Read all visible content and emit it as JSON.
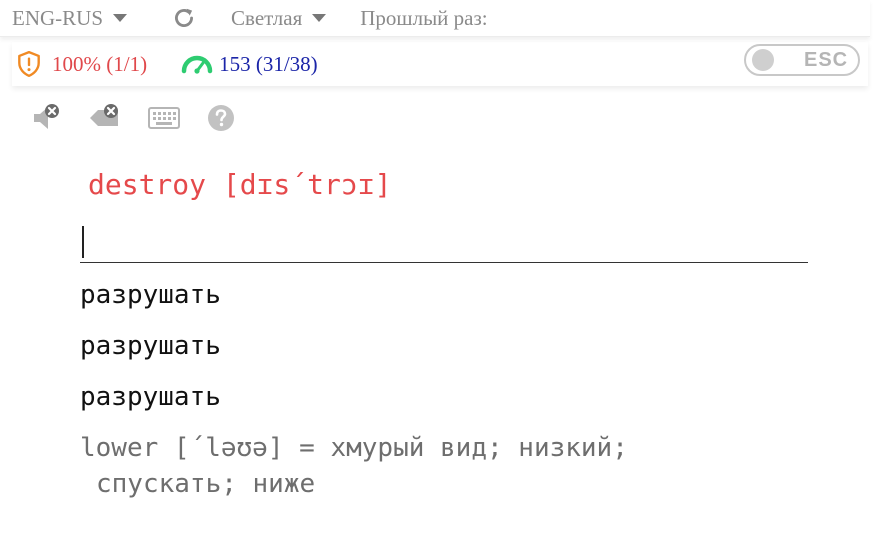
{
  "topbar": {
    "direction_label": "ENG-RUS",
    "theme_label": "Светлая",
    "last_time_label": "Прошлый раз:"
  },
  "stats": {
    "accuracy_text": "100% (1/1)",
    "speed_text": "153 (31/38)"
  },
  "esc_toggle": {
    "label": "ESC"
  },
  "toolbar": {
    "icons": [
      "mute-icon",
      "clear-icon",
      "keyboard-icon",
      "help-icon"
    ]
  },
  "card": {
    "word": "destroy [dɪs´trɔɪ]",
    "answer_value": "",
    "options": [
      "разрушать",
      "разрушать",
      "разрушать"
    ],
    "hint_line1": "lower [´ləʊə] = хмурый вид; низкий;",
    "hint_line2": "спускать; ниже"
  },
  "colors": {
    "word": "#e5494b",
    "accuracy": "#e0484b",
    "speed": "#1b25a8",
    "gauge": "#2ecc71",
    "shield": "#f08a24"
  }
}
